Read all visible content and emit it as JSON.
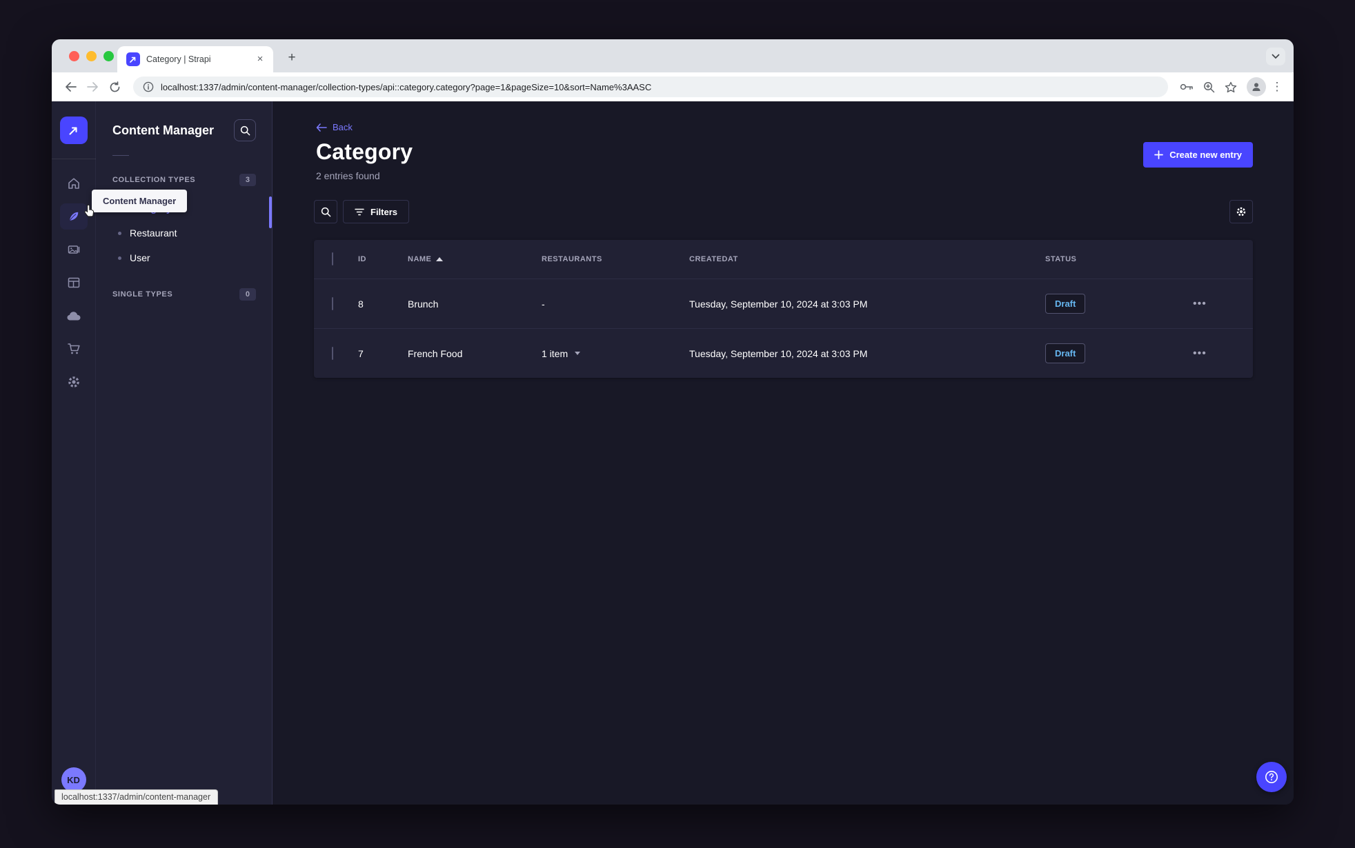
{
  "browser": {
    "tab_title": "Category | Strapi",
    "url": "localhost:1337/admin/content-manager/collection-types/api::category.category?page=1&pageSize=10&sort=Name%3AASC",
    "status_bar_link": "localhost:1337/admin/content-manager"
  },
  "sidebar": {
    "icons": [
      "strapi-logo",
      "home",
      "content-manager",
      "media-library",
      "content-type-builder",
      "cloud",
      "marketplace",
      "settings"
    ],
    "tooltip": "Content Manager",
    "user_initials": "KD"
  },
  "subnav": {
    "title": "Content Manager",
    "collection_types": {
      "label": "COLLECTION TYPES",
      "badge": "3",
      "items": [
        {
          "label": "Category",
          "active": true
        },
        {
          "label": "Restaurant",
          "active": false
        },
        {
          "label": "User",
          "active": false
        }
      ]
    },
    "single_types": {
      "label": "SINGLE TYPES",
      "badge": "0"
    }
  },
  "content": {
    "back": "Back",
    "title": "Category",
    "entries_count": "2 entries found",
    "create_button": "Create new entry",
    "filters_button": "Filters",
    "table": {
      "headers": {
        "id": "ID",
        "name": "NAME",
        "restaurants": "RESTAURANTS",
        "createdat": "CREATEDAT",
        "status": "STATUS"
      },
      "rows": [
        {
          "id": "8",
          "name": "Brunch",
          "restaurants": "-",
          "createdat": "Tuesday, September 10, 2024 at 3:03 PM",
          "status": "Draft"
        },
        {
          "id": "7",
          "name": "French Food",
          "restaurants": "1 item",
          "createdat": "Tuesday, September 10, 2024 at 3:03 PM",
          "status": "Draft"
        }
      ]
    }
  },
  "colors": {
    "primary": "#4945ff",
    "primary_light": "#7b79ff",
    "draft_text": "#66b7f1",
    "app_bg": "#181826",
    "panel_bg": "#212134"
  }
}
